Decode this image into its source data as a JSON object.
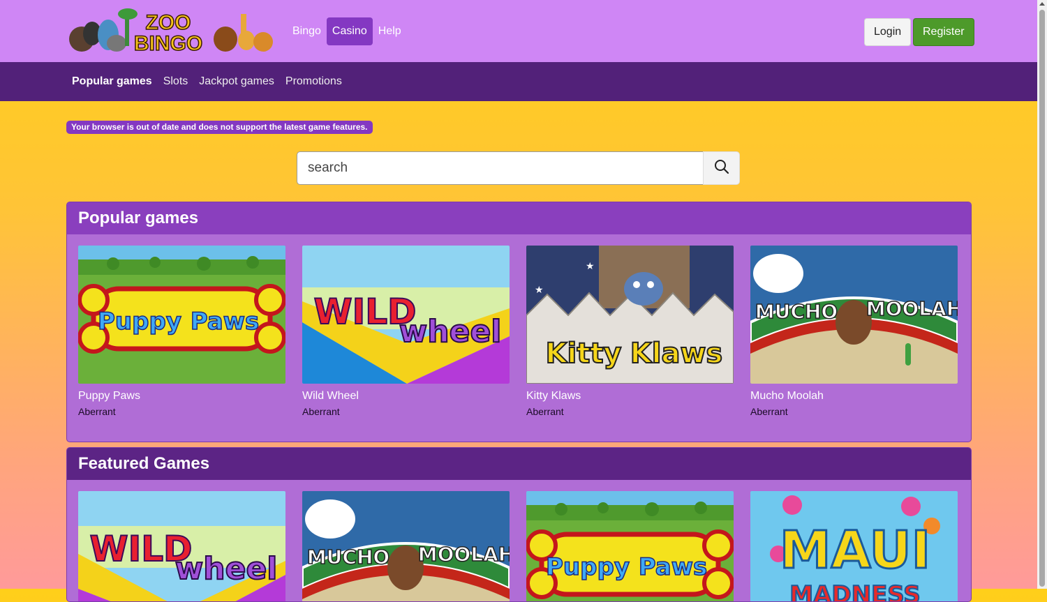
{
  "header": {
    "logo_line1": "ZOO",
    "logo_line2": "BINGO",
    "nav": [
      {
        "label": "Bingo",
        "active": false
      },
      {
        "label": "Casino",
        "active": true
      },
      {
        "label": "Help",
        "active": false
      }
    ],
    "login_label": "Login",
    "register_label": "Register"
  },
  "subnav": {
    "items": [
      {
        "label": "Popular games",
        "active": true
      },
      {
        "label": "Slots",
        "active": false
      },
      {
        "label": "Jackpot games",
        "active": false
      },
      {
        "label": "Promotions",
        "active": false
      }
    ]
  },
  "browser_warning": "Your browser is out of date and does not support the latest game features.",
  "search": {
    "placeholder": "search",
    "value": ""
  },
  "sections": [
    {
      "title": "Popular games",
      "games": [
        {
          "name": "Puppy Paws",
          "provider": "Aberrant",
          "art1": "Puppy",
          "art2": "Paws"
        },
        {
          "name": "Wild Wheel",
          "provider": "Aberrant",
          "art1": "WILD",
          "art2": "wheel"
        },
        {
          "name": "Kitty Klaws",
          "provider": "Aberrant",
          "art1": "Kitty",
          "art2": "Klaws"
        },
        {
          "name": "Mucho Moolah",
          "provider": "Aberrant",
          "art1": "MUCHO",
          "art2": "MOOLAH"
        }
      ]
    },
    {
      "title": "Featured Games",
      "games": [
        {
          "art1": "WILD",
          "art2": "wheel"
        },
        {
          "art1": "MUCHO",
          "art2": "MOOLAH"
        },
        {
          "art1": "Puppy",
          "art2": "Paws"
        },
        {
          "art1": "MAUI",
          "art2": "MADNESS"
        }
      ]
    }
  ],
  "colors": {
    "topbar": "#cf86f5",
    "subnav": "#522179",
    "active_tab": "#8438c2",
    "register": "#4d9a2a"
  }
}
